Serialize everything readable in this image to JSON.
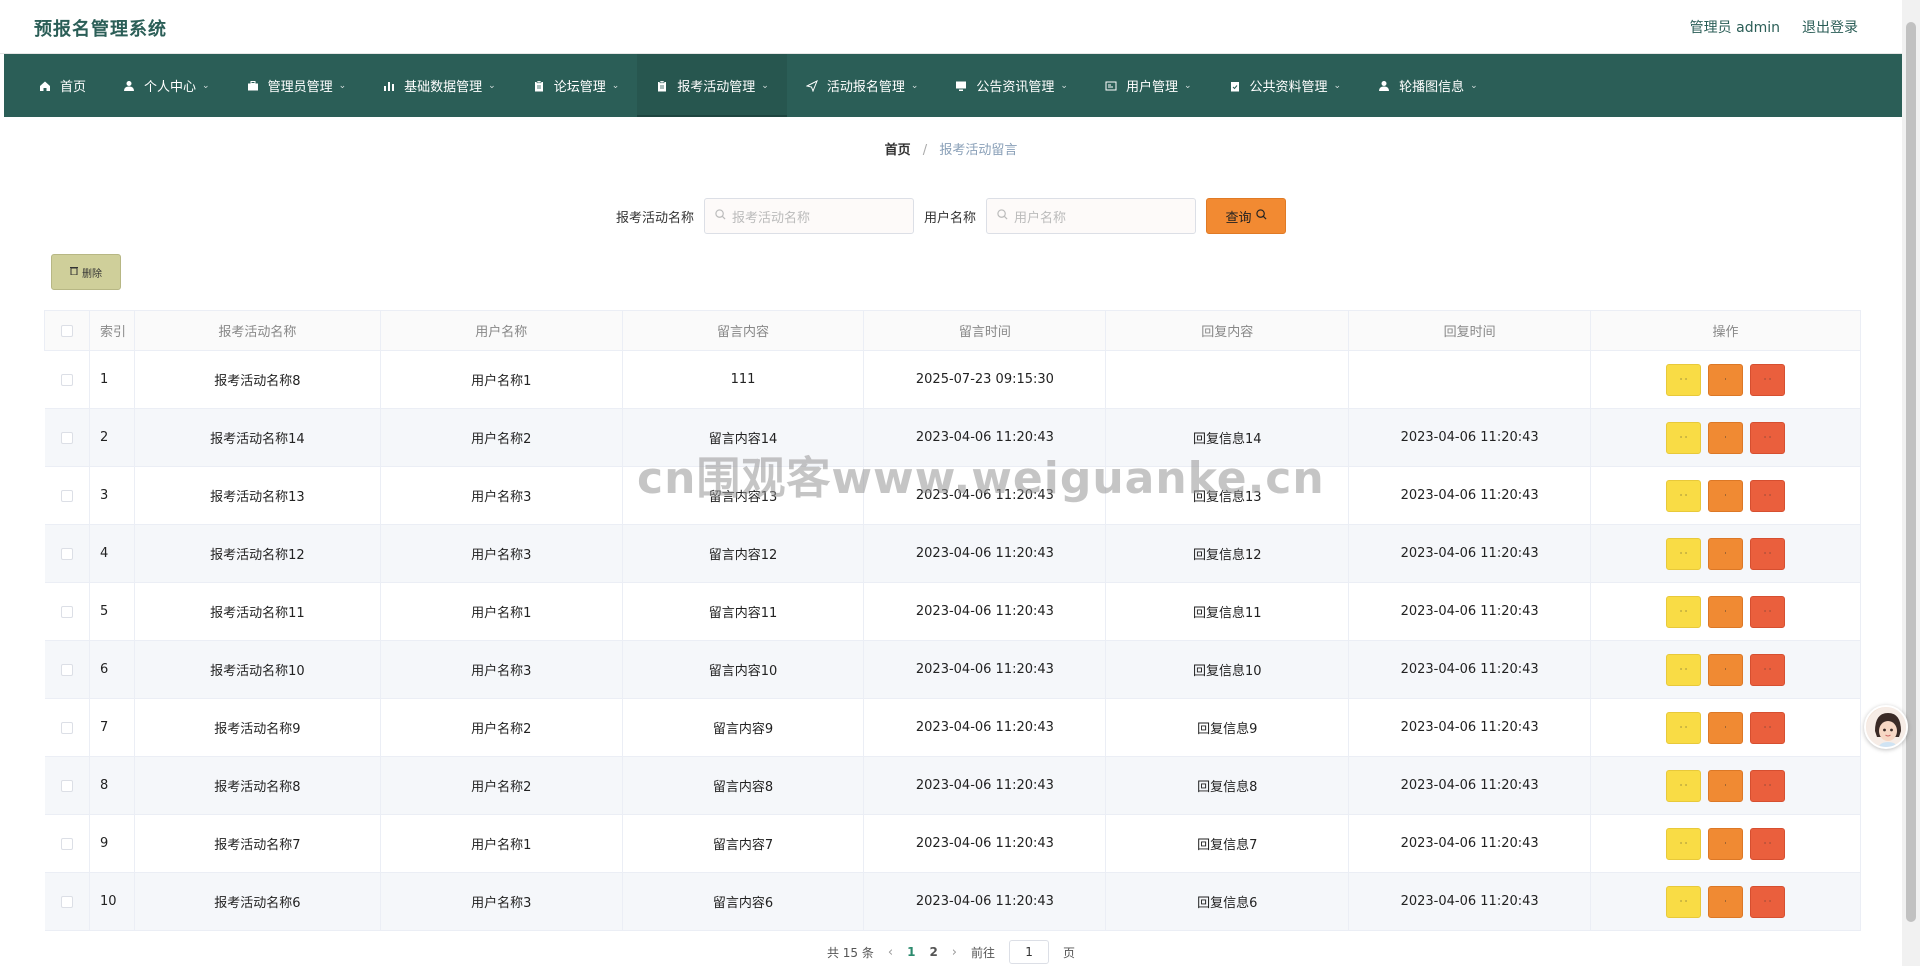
{
  "header": {
    "title": "预报名管理系统",
    "admin_label": "管理员 admin",
    "logout_label": "退出登录"
  },
  "nav": [
    {
      "label": "首页",
      "icon": "home-icon",
      "dropdown": false,
      "active": false
    },
    {
      "label": "个人中心",
      "icon": "user-icon",
      "dropdown": true,
      "active": false
    },
    {
      "label": "管理员管理",
      "icon": "briefcase-icon",
      "dropdown": true,
      "active": false
    },
    {
      "label": "基础数据管理",
      "icon": "bar-chart-icon",
      "dropdown": true,
      "active": false
    },
    {
      "label": "论坛管理",
      "icon": "clipboard-icon",
      "dropdown": true,
      "active": false
    },
    {
      "label": "报考活动管理",
      "icon": "clipboard-icon",
      "dropdown": true,
      "active": true
    },
    {
      "label": "活动报名管理",
      "icon": "send-icon",
      "dropdown": true,
      "active": false
    },
    {
      "label": "公告资讯管理",
      "icon": "monitor-icon",
      "dropdown": true,
      "active": false
    },
    {
      "label": "用户管理",
      "icon": "id-card-icon",
      "dropdown": true,
      "active": false
    },
    {
      "label": "公共资料管理",
      "icon": "clipboard-check-icon",
      "dropdown": true,
      "active": false
    },
    {
      "label": "轮播图信息",
      "icon": "user-icon",
      "dropdown": true,
      "active": false
    }
  ],
  "breadcrumb": {
    "home": "首页",
    "separator": "/",
    "current": "报考活动留言"
  },
  "search": {
    "activity_label": "报考活动名称",
    "activity_placeholder": "报考活动名称",
    "user_label": "用户名称",
    "user_placeholder": "用户名称",
    "query_label": "查询"
  },
  "toolbar": {
    "delete_label": "删除"
  },
  "table": {
    "columns": [
      "索引",
      "报考活动名称",
      "用户名称",
      "留言内容",
      "留言时间",
      "回复内容",
      "回复时间",
      "操作"
    ],
    "rows": [
      {
        "idx": "1",
        "activity": "报考活动名称8",
        "user": "用户名称1",
        "content": "111",
        "time": "2025-07-23 09:15:30",
        "reply": "",
        "reply_time": ""
      },
      {
        "idx": "2",
        "activity": "报考活动名称14",
        "user": "用户名称2",
        "content": "留言内容14",
        "time": "2023-04-06 11:20:43",
        "reply": "回复信息14",
        "reply_time": "2023-04-06 11:20:43"
      },
      {
        "idx": "3",
        "activity": "报考活动名称13",
        "user": "用户名称3",
        "content": "留言内容13",
        "time": "2023-04-06 11:20:43",
        "reply": "回复信息13",
        "reply_time": "2023-04-06 11:20:43"
      },
      {
        "idx": "4",
        "activity": "报考活动名称12",
        "user": "用户名称3",
        "content": "留言内容12",
        "time": "2023-04-06 11:20:43",
        "reply": "回复信息12",
        "reply_time": "2023-04-06 11:20:43"
      },
      {
        "idx": "5",
        "activity": "报考活动名称11",
        "user": "用户名称1",
        "content": "留言内容11",
        "time": "2023-04-06 11:20:43",
        "reply": "回复信息11",
        "reply_time": "2023-04-06 11:20:43"
      },
      {
        "idx": "6",
        "activity": "报考活动名称10",
        "user": "用户名称3",
        "content": "留言内容10",
        "time": "2023-04-06 11:20:43",
        "reply": "回复信息10",
        "reply_time": "2023-04-06 11:20:43"
      },
      {
        "idx": "7",
        "activity": "报考活动名称9",
        "user": "用户名称2",
        "content": "留言内容9",
        "time": "2023-04-06 11:20:43",
        "reply": "回复信息9",
        "reply_time": "2023-04-06 11:20:43"
      },
      {
        "idx": "8",
        "activity": "报考活动名称8",
        "user": "用户名称2",
        "content": "留言内容8",
        "time": "2023-04-06 11:20:43",
        "reply": "回复信息8",
        "reply_time": "2023-04-06 11:20:43"
      },
      {
        "idx": "9",
        "activity": "报考活动名称7",
        "user": "用户名称1",
        "content": "留言内容7",
        "time": "2023-04-06 11:20:43",
        "reply": "回复信息7",
        "reply_time": "2023-04-06 11:20:43"
      },
      {
        "idx": "10",
        "activity": "报考活动名称6",
        "user": "用户名称3",
        "content": "留言内容6",
        "time": "2023-04-06 11:20:43",
        "reply": "回复信息6",
        "reply_time": "2023-04-06 11:20:43"
      }
    ],
    "row_actions": [
      {
        "name": "view",
        "color": "#f9dc45",
        "label": "· ·"
      },
      {
        "name": "edit",
        "color": "#f08a33",
        "label": "·"
      },
      {
        "name": "delete",
        "color": "#ea5f3d",
        "label": "· ·"
      }
    ]
  },
  "pagination": {
    "total_text": "共 15 条",
    "pages": [
      "1",
      "2"
    ],
    "current_page": "1",
    "goto_prefix": "前往",
    "goto_value": "1",
    "goto_suffix": "页"
  },
  "watermark": "cn围观客www.weiguanke.cn",
  "colors": {
    "primary": "#2b5e57",
    "query_button": "#f28a32",
    "delete_button": "#cfcf9a",
    "action_view": "#f9dc45",
    "action_edit": "#f08a33",
    "action_delete": "#ea5f3d"
  }
}
